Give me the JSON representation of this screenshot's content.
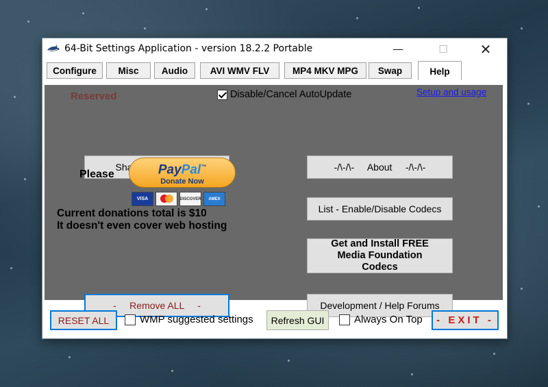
{
  "window": {
    "title": "64-Bit Settings Application - version 18.2.2 Portable",
    "controls": {
      "minimize": "—",
      "maximize": "☐",
      "close": "✕"
    }
  },
  "tabs": [
    {
      "label": "Configure",
      "active": false
    },
    {
      "label": "Misc",
      "active": false
    },
    {
      "label": "Audio",
      "active": false
    },
    {
      "label": "AVI WMV FLV",
      "active": false
    },
    {
      "label": "MP4 MKV MPG",
      "active": false
    },
    {
      "label": "Swap",
      "active": false
    },
    {
      "label": "Help",
      "active": true
    }
  ],
  "help_panel": {
    "reserved_label": "Reserved",
    "autoupdate": {
      "label": "Disable/Cancel AutoUpdate",
      "checked": true
    },
    "setup_link": "Setup and usage",
    "website_button": "Shark007's website",
    "about_button": "-/\\-/\\-     About     -/\\-/\\-",
    "list_codecs_button": "List - Enable/Disable Codecs",
    "mf_codecs_button": "Get and Install FREE Media Foundation Codecs",
    "dev_forums_button": "Development / Help Forums",
    "remove_all_button": "-     Remove ALL     -",
    "please_label": "Please",
    "paypal": {
      "pay": "Pay",
      "pal": "Pal",
      "tm": "™",
      "sub": "Donate Now"
    },
    "cards": [
      "VISA",
      "MC",
      "DISCOVER",
      "AMEX"
    ],
    "donation_line1": "Current donations total is $10",
    "donation_line2": "It doesn't even cover web hosting"
  },
  "bottom_bar": {
    "reset_button": "RESET ALL",
    "wmp_settings": {
      "label": "WMP suggested settings",
      "checked": false
    },
    "refresh_button": "Refresh GUI",
    "always_on_top": {
      "label": "Always On Top",
      "checked": false
    },
    "exit_button": "- EXIT -"
  },
  "colors": {
    "panel_bg": "#696969",
    "reserved_text": "#7a3a3a",
    "remove_text": "#8b1a1a",
    "exit_text": "#c0201a",
    "link": "#1a1aee"
  }
}
